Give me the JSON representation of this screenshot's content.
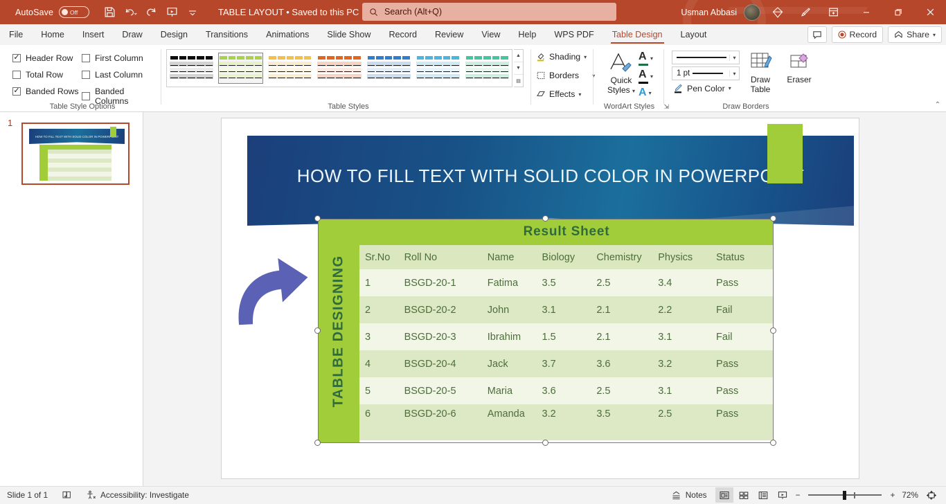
{
  "titlebar": {
    "autosave_label": "AutoSave",
    "autosave_state": "Off",
    "save_icon": "save-icon",
    "undo_icon": "undo-icon",
    "redo_icon": "redo-icon",
    "present_icon": "start-presentation-icon",
    "more_icon": "customize-quick-access-icon",
    "doc_title": "TABLE LAYOUT • Saved to this PC",
    "accent": "#b7472a"
  },
  "search": {
    "placeholder": "Search (Alt+Q)",
    "icon": "search-icon"
  },
  "account": {
    "user_name": "Usman Abbasi",
    "avatar": "user-avatar",
    "diamond_icon": "microsoft-365-diamond-icon",
    "pen_icon": "ink-pen-icon",
    "ribbon_display_icon": "ribbon-display-options-icon"
  },
  "window_controls": {
    "minimize": "minimize-icon",
    "restore": "restore-icon",
    "close": "close-icon"
  },
  "ribbon_tabs": {
    "items": [
      {
        "label": "File"
      },
      {
        "label": "Home"
      },
      {
        "label": "Insert"
      },
      {
        "label": "Draw"
      },
      {
        "label": "Design"
      },
      {
        "label": "Transitions"
      },
      {
        "label": "Animations"
      },
      {
        "label": "Slide Show"
      },
      {
        "label": "Record"
      },
      {
        "label": "Review"
      },
      {
        "label": "View"
      },
      {
        "label": "Help"
      },
      {
        "label": "WPS PDF"
      },
      {
        "label": "Table Design"
      },
      {
        "label": "Layout"
      }
    ],
    "active": "Table Design",
    "comments_label": "",
    "record_label": "Record",
    "share_label": "Share",
    "collapse_icon": "collapse-ribbon-icon"
  },
  "table_style_options": {
    "group_label": "Table Style Options",
    "checkboxes": [
      {
        "label": "Header Row",
        "checked": true
      },
      {
        "label": "First Column",
        "checked": false
      },
      {
        "label": "Total Row",
        "checked": false
      },
      {
        "label": "Last Column",
        "checked": false
      },
      {
        "label": "Banded Rows",
        "checked": true
      },
      {
        "label": "Banded Columns",
        "checked": false
      }
    ]
  },
  "table_styles": {
    "group_label": "Table Styles",
    "selected_index": 1,
    "thumbs": [
      {
        "name": "no-style-table-grid",
        "header": "#0d0d0d",
        "band_a": "#d4d4d4",
        "band_b": "#ececec",
        "line": "#0d0d0d"
      },
      {
        "name": "themed-style-green",
        "header": "#a9d14b",
        "band_a": "#e7f2cd",
        "band_b": "#f4f9e8",
        "line": "#1b1b1b"
      },
      {
        "name": "themed-style-gold",
        "header": "#f2c14a",
        "band_a": "#fbeed0",
        "band_b": "#fdf7e9",
        "line": "#1b1b1b"
      },
      {
        "name": "themed-style-orange",
        "header": "#e2661d",
        "band_a": "#f8d4c4",
        "band_b": "#fcebe3",
        "line": "#1b1b1b"
      },
      {
        "name": "themed-style-blue",
        "header": "#2f7fd1",
        "band_a": "#ccdcef",
        "band_b": "#e6eef8",
        "line": "#1b1b1b"
      },
      {
        "name": "themed-style-lightblue",
        "header": "#4cb5e0",
        "band_a": "#cfe9f5",
        "band_b": "#e9f5fa",
        "line": "#1b1b1b"
      },
      {
        "name": "themed-style-teal",
        "header": "#45c5a0",
        "band_a": "#cfeee2",
        "band_b": "#e9f7f1",
        "line": "#1b1b1b"
      }
    ],
    "scroll_up": "▲",
    "scroll_down": "▼",
    "more": "▤"
  },
  "shading_group": {
    "shading_label": "Shading",
    "borders_label": "Borders",
    "effects_label": "Effects"
  },
  "wordart": {
    "group_label": "WordArt Styles",
    "quick_styles_label_1": "Quick",
    "quick_styles_label_2": "Styles",
    "text_fill_icon": "text-fill-icon",
    "text_fill_color": "#1e7145",
    "text_outline_icon": "text-outline-icon",
    "text_outline_color": "#000000",
    "text_effects_icon": "text-effects-icon",
    "text_effects_color": "#2e9bd6",
    "dialog_launcher": "dialog-box-launcher"
  },
  "draw_borders": {
    "group_label": "Draw Borders",
    "pen_style_value": "",
    "pen_weight_value": "1 pt",
    "pen_color_label": "Pen Color",
    "draw_table_label_1": "Draw",
    "draw_table_label_2": "Table",
    "eraser_label": "Eraser"
  },
  "thumbnail_panel": {
    "slide_number": "1"
  },
  "slide": {
    "title": "HOW TO FILL TEXT WITH SOLID COLOR IN POWERPOINT",
    "banner_color_dark": "#1b3f7a",
    "banner_color_light": "#1b6f9c",
    "accent_green": "#a2cd3a",
    "arrow_color": "#5b62b5",
    "vertical_label": "TABLBE DESIGNING"
  },
  "result_table": {
    "title": "Result  Sheet",
    "headers": [
      "Sr.No",
      "Roll No",
      "Name",
      "Biology",
      "Chemistry",
      "Physics",
      "Status"
    ],
    "rows": [
      [
        "1",
        "BSGD-20-1",
        "Fatima",
        "3.5",
        "2.5",
        "3.4",
        "Pass"
      ],
      [
        "2",
        "BSGD-20-2",
        "John",
        "3.1",
        "2.1",
        "2.2",
        "Fail"
      ],
      [
        "3",
        "BSGD-20-3",
        "Ibrahim",
        "1.5",
        "2.1",
        "3.1",
        "Fail"
      ],
      [
        "4",
        "BSGD-20-4",
        "Jack",
        "3.7",
        "3.6",
        "3.2",
        "Pass"
      ],
      [
        "5",
        "BSGD-20-5",
        "Maria",
        "3.6",
        "2.5",
        "3.1",
        "Pass"
      ],
      [
        "6",
        "BSGD-20-6",
        "Amanda",
        "3.2",
        "3.5",
        "2.5",
        "Pass"
      ]
    ]
  },
  "statusbar": {
    "slide_indicator": "Slide 1 of 1",
    "language_icon": "spell-check-icon",
    "accessibility": "Accessibility: Investigate",
    "notes_label": "Notes",
    "view_normal": "normal-view-icon",
    "view_sorter": "slide-sorter-icon",
    "view_reading": "reading-view-icon",
    "view_slideshow": "slideshow-icon",
    "zoom_out": "−",
    "zoom_in": "+",
    "zoom_level": "72%",
    "fit_icon": "fit-slide-icon"
  }
}
